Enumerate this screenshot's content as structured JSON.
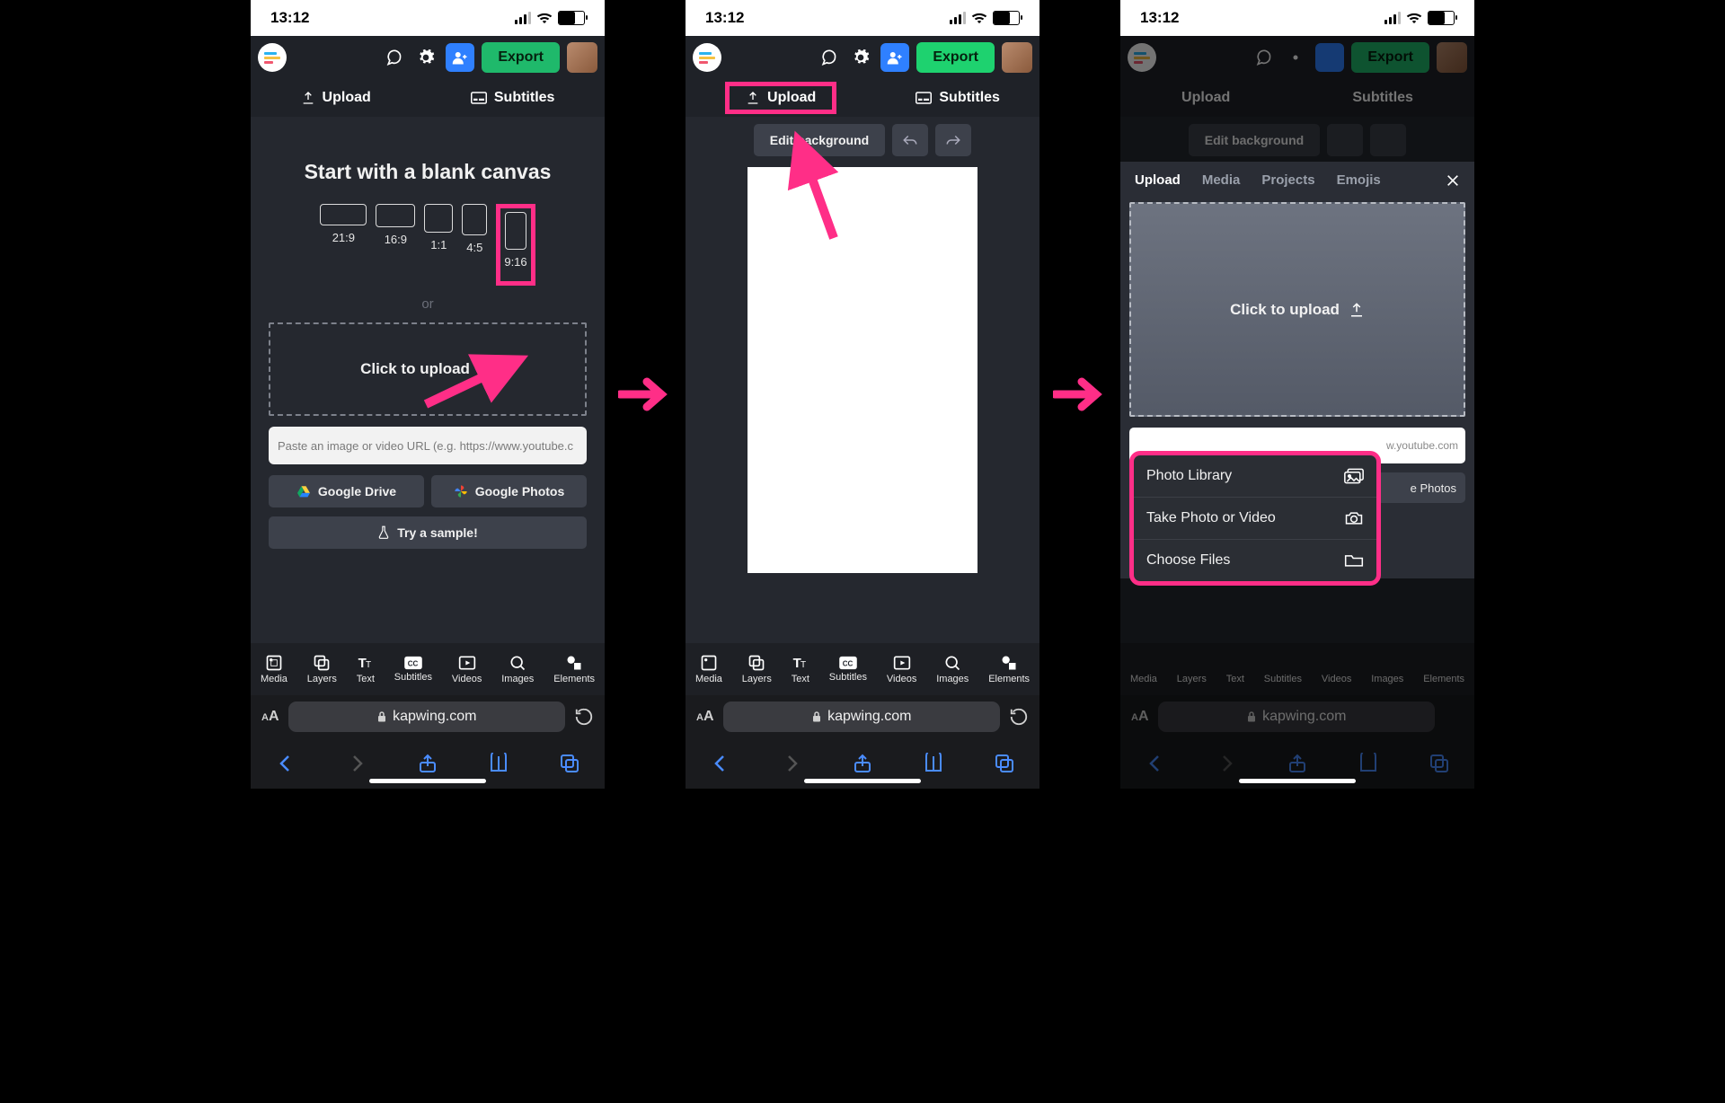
{
  "status": {
    "time": "13:12"
  },
  "topbar": {
    "export": "Export"
  },
  "tabs": {
    "upload": "Upload",
    "subtitles": "Subtitles"
  },
  "screen1": {
    "heading": "Start with a blank canvas",
    "ratios": {
      "r1": "21:9",
      "r2": "16:9",
      "r3": "1:1",
      "r4": "4:5",
      "r5": "9:16"
    },
    "or": "or",
    "dropzone": "Click to upload",
    "url_placeholder": "Paste an image or video URL (e.g. https://www.youtube.c",
    "gdrive": "Google Drive",
    "gphotos": "Google Photos",
    "sample": "Try a sample!"
  },
  "screen2": {
    "editbg": "Edit background"
  },
  "screen3": {
    "panel_tabs": {
      "upload": "Upload",
      "media": "Media",
      "projects": "Projects",
      "emojis": "Emojis"
    },
    "dropzone": "Click to upload",
    "stub_input": "w.youtube.com",
    "stub_btn": "e Photos",
    "sheet": {
      "photolib": "Photo Library",
      "takephoto": "Take Photo or Video",
      "choosefiles": "Choose Files"
    }
  },
  "bottomnav": {
    "media": "Media",
    "layers": "Layers",
    "text": "Text",
    "subtitles": "Subtitles",
    "videos": "Videos",
    "images": "Images",
    "elements": "Elements"
  },
  "safari": {
    "domain": "kapwing.com"
  }
}
